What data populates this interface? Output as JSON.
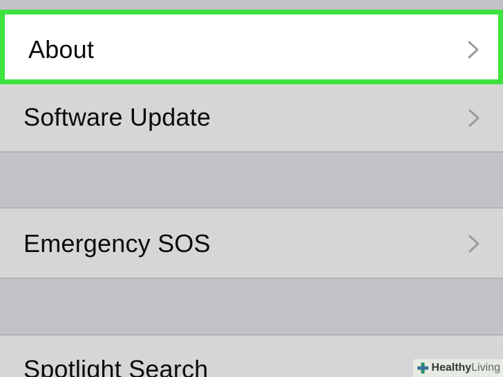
{
  "settings_list": {
    "items": [
      {
        "label": "About",
        "highlighted": true,
        "chevron_icon": "chevron-right-icon"
      },
      {
        "label": "Software Update",
        "chevron_icon": "chevron-right-icon"
      },
      {
        "label": "Emergency SOS",
        "chevron_icon": "chevron-right-icon"
      },
      {
        "label": "Spotlight Search"
      }
    ]
  },
  "watermark": {
    "bold_text": "Healthy",
    "light_text": "Living",
    "icon": "cross-logo-icon"
  },
  "colors": {
    "highlight_border": "#3de23f",
    "row_background": "#d6d6d6",
    "group_gap": "#c2c2c7",
    "highlighted_row_background": "#ffffff",
    "chevron": "#9a9aa0"
  }
}
